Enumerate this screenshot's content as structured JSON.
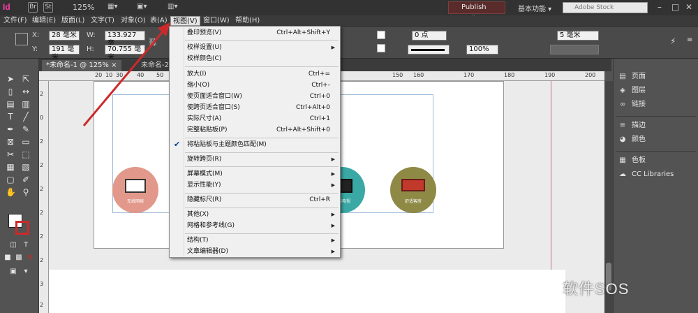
{
  "titlebar": {
    "logo": "Id",
    "br_label": "Br",
    "st_label": "St",
    "zoom": "125%",
    "publish_label": "Publish Online",
    "workspace_label": "基本功能",
    "search_placeholder": "Adobe Stock",
    "min_label": "–",
    "max_label": "□",
    "close_label": "✕"
  },
  "menubar": {
    "items": [
      "文件(F)",
      "编辑(E)",
      "版面(L)",
      "文字(T)",
      "对象(O)",
      "表(A)",
      "视图(V)",
      "窗口(W)",
      "帮助(H)"
    ]
  },
  "controlbar": {
    "x_label": "X:",
    "x_value": "28 毫米",
    "y_label": "Y:",
    "y_value": "191 毫米",
    "w_label": "W:",
    "w_value": "133.927 毫",
    "h_label": "H:",
    "h_value": "70.755 毫米",
    "stroke_weight": "0 点",
    "opacity": "100%",
    "mm_value": "5 毫米"
  },
  "tabs": [
    {
      "label": "*未命名-1 @ 125%",
      "close": "×"
    },
    {
      "label": "未命名-2 @ 47%",
      "close": ""
    }
  ],
  "ruler": {
    "top_ticks": [
      "20",
      "10",
      "30",
      "40",
      "50",
      "150",
      "160",
      "170",
      "180",
      "190",
      "200"
    ],
    "left_ticks": [
      "2",
      "0",
      "2",
      "2",
      "2",
      "2",
      "2",
      "2",
      "3",
      "2"
    ]
  },
  "canvas": {
    "circles": [
      {
        "label": "无线网络",
        "color": "#e2988a",
        "icon": "laptop-icon"
      },
      {
        "label": "有线电视",
        "color": "#3aa8a4",
        "icon": "tv-icon"
      },
      {
        "label": "舒适客房",
        "color": "#8e8a46",
        "icon": "bed-icon"
      }
    ]
  },
  "panel": {
    "items": [
      {
        "label": "页面",
        "icon": "pages-icon"
      },
      {
        "label": "图层",
        "icon": "layers-icon"
      },
      {
        "label": "链接",
        "icon": "links-icon"
      },
      {
        "label": "描边",
        "icon": "stroke-icon"
      },
      {
        "label": "颜色",
        "icon": "color-icon"
      },
      {
        "label": "色板",
        "icon": "swatches-icon"
      },
      {
        "label": "CC Libraries",
        "icon": "cc-libraries-icon"
      }
    ]
  },
  "view_menu": {
    "items": [
      {
        "label": "叠印预览(V)",
        "shortcut": "Ctrl+Alt+Shift+Y"
      },
      {
        "label": "校样设置(U)",
        "shortcut": "",
        "submenu": true
      },
      {
        "label": "校样颜色(C)",
        "shortcut": ""
      },
      {
        "label": "放大(I)",
        "shortcut": "Ctrl+="
      },
      {
        "label": "缩小(O)",
        "shortcut": "Ctrl+-"
      },
      {
        "label": "使页面适合窗口(W)",
        "shortcut": "Ctrl+0"
      },
      {
        "label": "使跨页适合窗口(S)",
        "shortcut": "Ctrl+Alt+0"
      },
      {
        "label": "实际尺寸(A)",
        "shortcut": "Ctrl+1"
      },
      {
        "label": "完整粘贴板(P)",
        "shortcut": "Ctrl+Alt+Shift+0"
      },
      {
        "label": "将粘贴板与主题颜色匹配(M)",
        "shortcut": "",
        "checked": true
      },
      {
        "label": "旋转跨页(R)",
        "shortcut": "",
        "submenu": true
      },
      {
        "label": "屏幕模式(M)",
        "shortcut": "",
        "submenu": true
      },
      {
        "label": "显示性能(Y)",
        "shortcut": "",
        "submenu": true
      },
      {
        "label": "隐藏标尺(R)",
        "shortcut": "Ctrl+R"
      },
      {
        "label": "其他(X)",
        "shortcut": "",
        "submenu": true
      },
      {
        "label": "网格和参考线(G)",
        "shortcut": "",
        "submenu": true
      },
      {
        "label": "结构(T)",
        "shortcut": "",
        "submenu": true
      },
      {
        "label": "文章编辑器(D)",
        "shortcut": "",
        "submenu": true
      }
    ]
  },
  "watermark": "软件SOS",
  "colors": {
    "accent_arrow": "#cc2a2a",
    "menu_bg": "#f0f0f0",
    "check": "#0b3d91"
  }
}
